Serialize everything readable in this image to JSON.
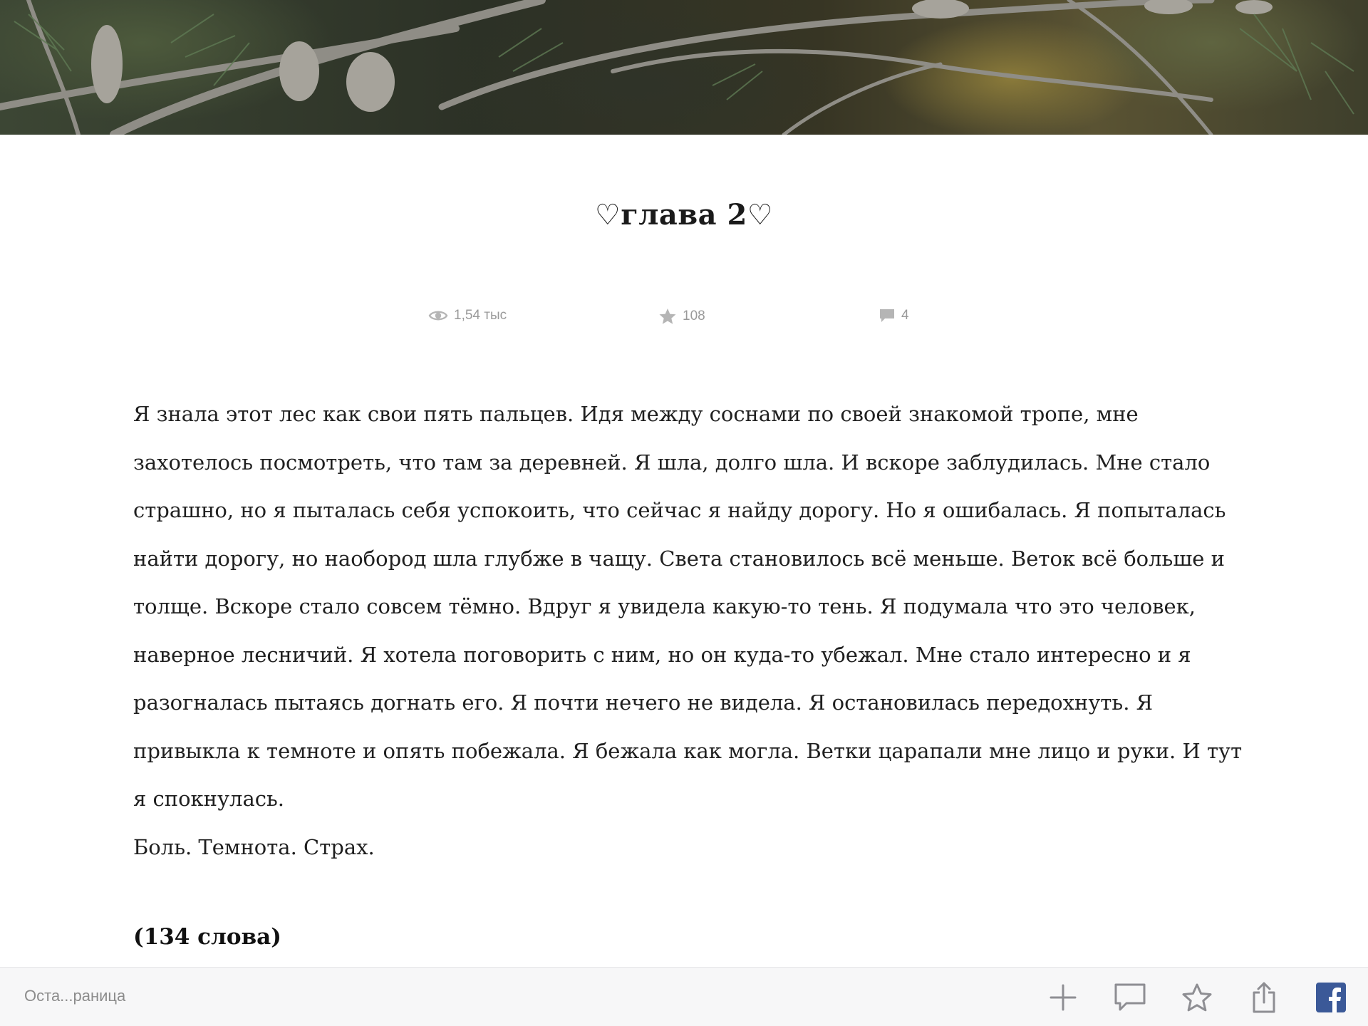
{
  "chapter": {
    "title": "♡глава 2♡"
  },
  "stats": {
    "views": "1,54 тыс",
    "stars": "108",
    "comments": "4"
  },
  "article": {
    "paragraphs": [
      "Я знала этот лес как свои пять пальцев. Идя между соснами по своей знакомой тропе, мне захотелось посмотреть, что там за деревней. Я шла, долго шла. И вскоре заблудилась. Мне стало страшно, но я пыталась себя успокоить, что сейчас я найду дорогу. Но я ошибалась. Я попыталась найти дорогу, но наобород шла глубже в чащу. Света становилось всё меньше. Веток всё больше и толще. Вскоре стало совсем тёмно. Вдруг я увидела какую-то тень. Я подумала что это человек, наверное лесничий. Я хотела поговорить с ним, но он куда-то убежал. Мне стало интересно и я разогналась пытаясь догнать его. Я почти нечего не видела. Я остановилась передохнуть. Я привыкла к темноте и опять побежала. Я бежала как могла. Ветки царапали мне лицо и руки. И тут я спокнулась.",
      "Боль. Темнота. Страх."
    ],
    "word_count": "(134 слова)"
  },
  "toolbar": {
    "label": "Оста...раница",
    "icons": [
      "plus-icon",
      "comment-icon",
      "star-icon",
      "share-icon",
      "facebook-icon"
    ],
    "facebook_color": "#3b5998",
    "icon_color": "#8e8e93"
  }
}
